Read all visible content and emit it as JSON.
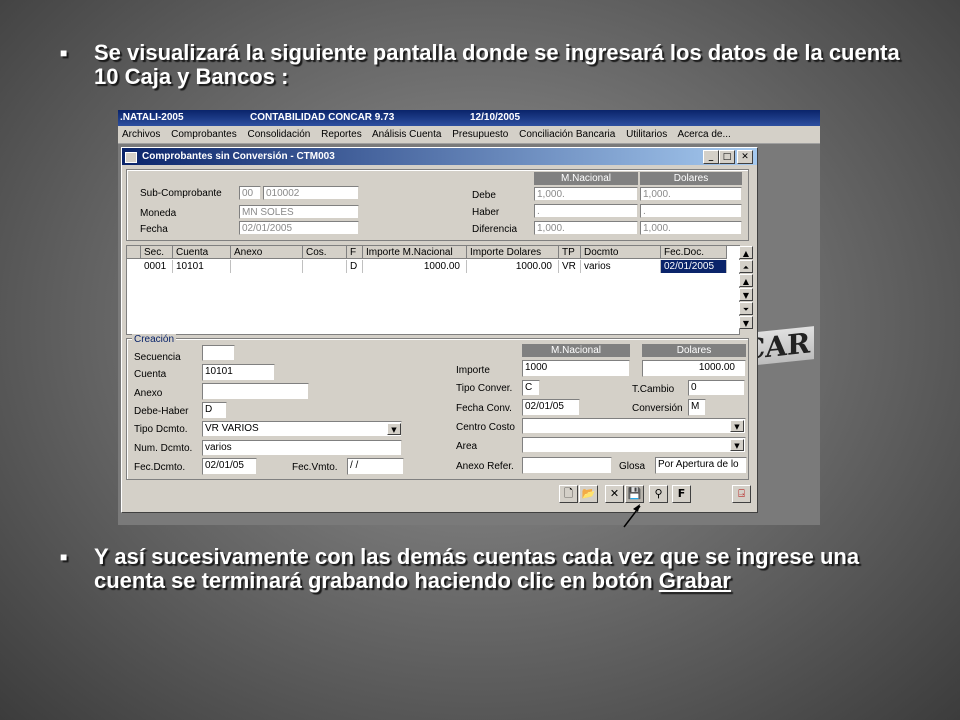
{
  "slide": {
    "bullet1": "Se visualizará la siguiente pantalla donde se ingresará los datos de la cuenta 10 Caja y Bancos :",
    "bullet2_part1": "Y así sucesivamente con las demás cuentas  cada vez que se ingrese una cuenta se terminará grabando haciendo clic en  botón ",
    "bullet2_part2": "Grabar"
  },
  "app": {
    "title_company": ".NATALI-2005",
    "title_app": "CONTABILIDAD CONCAR 9.73",
    "title_date": "12/10/2005",
    "menu": [
      "Archivos",
      "Comprobantes",
      "Consolidación",
      "Reportes",
      "Análisis Cuenta",
      "Presupuesto",
      "Conciliación Bancaria",
      "Utilitarios",
      "Acerca de..."
    ],
    "logo_fragment": "CAR"
  },
  "window": {
    "title": "Comprobantes sin Conversión - CTM003",
    "btn_min": "_",
    "btn_max": "□",
    "btn_close": "✕"
  },
  "header": {
    "subcomprobante_label": "Sub-Comprobante",
    "subcomprobante_code": "00",
    "subcomprobante_num": "010002",
    "moneda_label": "Moneda",
    "moneda_value": "MN      SOLES",
    "fecha_label": "Fecha",
    "fecha_value": "02/01/2005",
    "col_nacional": "M.Nacional",
    "col_dolares": "Dolares",
    "debe_label": "Debe",
    "debe_nac": "1,000.",
    "debe_dol": "1,000.",
    "haber_label": "Haber",
    "haber_nac": ".",
    "haber_dol": ".",
    "diferencia_label": "Diferencia",
    "diferencia_nac": "1,000.",
    "diferencia_dol": "1,000."
  },
  "grid": {
    "columns": [
      "Sec.",
      "Cuenta",
      "Anexo",
      "Cos.",
      "F",
      "Importe M.Nacional",
      "Importe Dolares",
      "TP",
      "Docmto",
      "Fec.Doc."
    ],
    "row": [
      "0001",
      "10101",
      "",
      "",
      "D",
      "1000.00",
      "1000.00",
      "VR",
      "varios",
      "02/01/2005"
    ]
  },
  "creacion": {
    "group_label": "Creación",
    "secuencia_label": "Secuencia",
    "secuencia_value": "",
    "cuenta_label": "Cuenta",
    "cuenta_value": "10101",
    "anexo_label": "Anexo",
    "anexo_value": "",
    "debehaber_label": "Debe-Haber",
    "debehaber_value": "D",
    "tipodcmto_label": "Tipo Dcmto.",
    "tipodcmto_value": "VR       VARIOS",
    "numdcmto_label": "Num. Dcmto.",
    "numdcmto_value": "varios",
    "fecdcmto_label": "Fec.Dcmto.",
    "fecdcmto_value": "02/01/05",
    "fecvmto_label": "Fec.Vmto.",
    "fecvmto_value": " / /",
    "col_nacional": "M.Nacional",
    "col_dolares": "Dolares",
    "importe_label": "Importe",
    "importe_nac": "1000",
    "importe_dol": "1000.00",
    "tipoconver_label": "Tipo Conver.",
    "tipoconver_value": "C",
    "tcambio_label": "T.Cambio",
    "tcambio_value": "0",
    "fechaconv_label": "Fecha Conv.",
    "fechaconv_value": "02/01/05",
    "conversion_label": "Conversión",
    "conversion_value": "M",
    "centrocosto_label": "Centro Costo",
    "centrocosto_value": "",
    "area_label": "Area",
    "area_value": "",
    "anexoref_label": "Anexo Refer.",
    "anexoref_value": "",
    "glosa_label": "Glosa",
    "glosa_value": "Por Apertura de lo"
  },
  "toolbar": {
    "new_icon": "new-document-icon",
    "open_icon": "open-folder-icon",
    "delete_icon": "delete-x-icon",
    "save_icon": "save-disk-icon",
    "find_icon": "binoculars-icon",
    "f_label": "F",
    "exit_icon": "exit-door-icon"
  }
}
